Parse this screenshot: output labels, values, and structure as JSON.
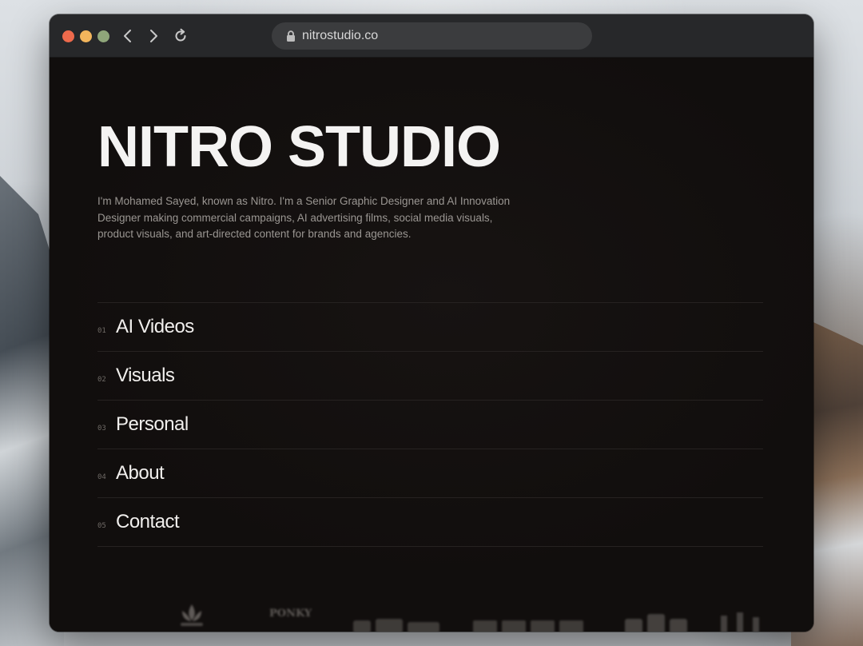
{
  "browser": {
    "url": "nitrostudio.co"
  },
  "hero": {
    "title": "NITRO STUDIO",
    "description": "I'm Mohamed Sayed, known as Nitro. I'm a Senior Graphic Designer and AI Innovation Designer making commercial campaigns, AI advertising films, social media visuals, product visuals, and art-directed content for brands and agencies."
  },
  "menu": {
    "items": [
      {
        "num": "01",
        "label": "AI Videos"
      },
      {
        "num": "02",
        "label": "Visuals"
      },
      {
        "num": "03",
        "label": "Personal"
      },
      {
        "num": "04",
        "label": "About"
      },
      {
        "num": "05",
        "label": "Contact"
      }
    ]
  },
  "logos": {
    "ponky": "PONKY"
  },
  "colors": {
    "background": "#110e0d",
    "text": "#f4f3f2",
    "muted": "#9a9692",
    "traffic_red": "#ee6a4c",
    "traffic_yellow": "#f2b55c",
    "traffic_green": "#8fa67a"
  }
}
